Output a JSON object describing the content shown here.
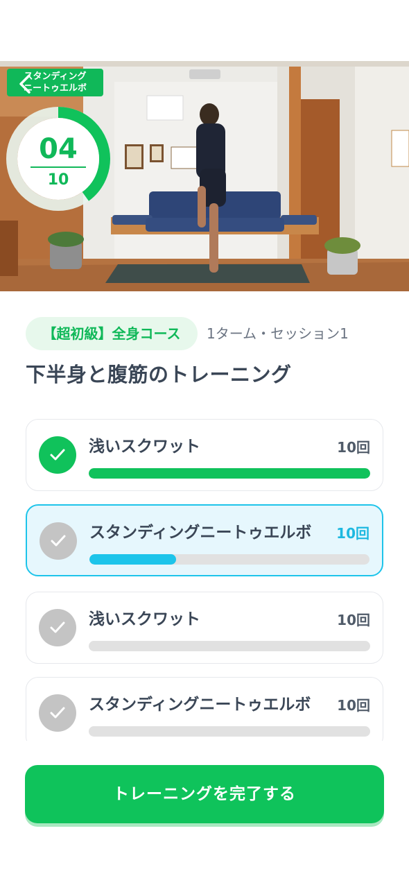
{
  "video": {
    "exercise_badge": [
      "スタンディング",
      "ニートゥエルボ"
    ],
    "counter": {
      "current": "04",
      "total": "10",
      "progress": 0.4
    }
  },
  "course": {
    "pill": "【超初級】全身コース",
    "session": "1ターム・セッション1",
    "title": "下半身と腹筋のトレーニング"
  },
  "exercises": [
    {
      "name": "浅いスクワット",
      "reps": "10回",
      "done": true,
      "active": false,
      "progress": 1.0
    },
    {
      "name": "スタンディングニートゥエルボ",
      "reps": "10回",
      "done": false,
      "active": true,
      "progress": 0.31
    },
    {
      "name": "浅いスクワット",
      "reps": "10回",
      "done": false,
      "active": false,
      "progress": 0
    },
    {
      "name": "スタンディングニートゥエルボ",
      "reps": "10回",
      "done": false,
      "active": false,
      "progress": 0
    }
  ],
  "colors": {
    "green": "#10c25b",
    "cyan": "#1dc4ea",
    "track": "#e1e1e1",
    "check_inactive": "#c4c4c4"
  },
  "icons": {
    "back": "chevron-left-icon",
    "check": "checkmark-icon"
  },
  "complete_button": "トレーニングを完了する"
}
